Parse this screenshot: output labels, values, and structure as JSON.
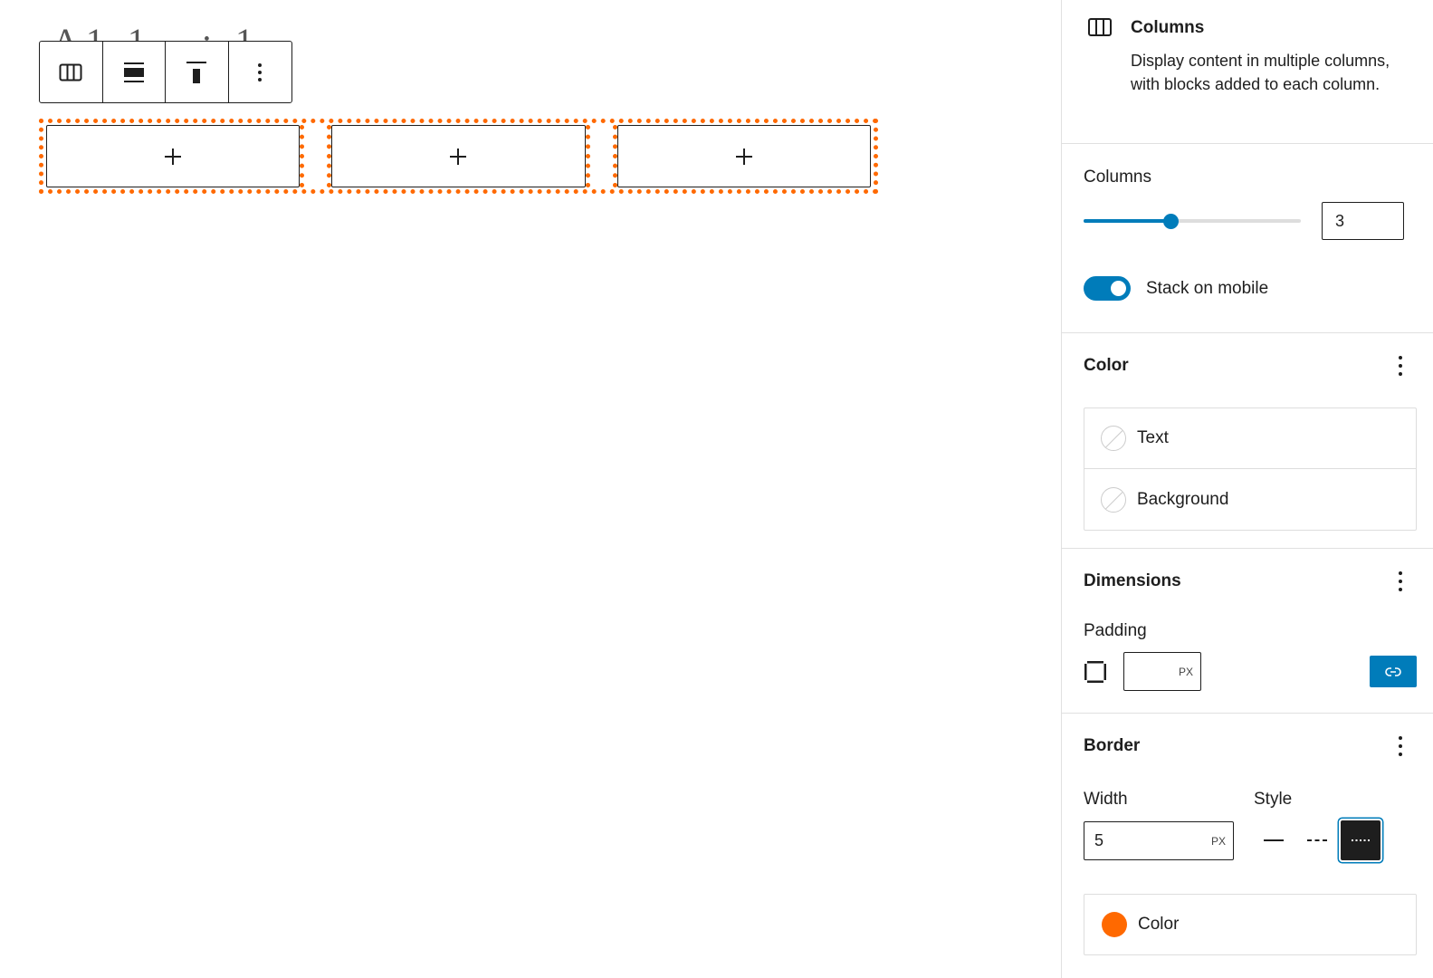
{
  "canvas": {
    "ghost_title": "A1 1 , : 1",
    "toolbar": {
      "items": [
        {
          "name": "block-type-columns-button",
          "icon": "columns-icon"
        },
        {
          "name": "align-button",
          "icon": "align-wide-icon"
        },
        {
          "name": "vertical-align-button",
          "icon": "align-top-icon"
        },
        {
          "name": "more-options-button",
          "icon": "vertical-ellipsis-icon"
        }
      ]
    },
    "columns": [
      {
        "appender": "+"
      },
      {
        "appender": "+"
      },
      {
        "appender": "+"
      }
    ],
    "border_color": "#ff6900"
  },
  "sidebar": {
    "block_card": {
      "title": "Columns",
      "description": "Display content in multiple columns, with blocks added to each column."
    },
    "settings": {
      "columns_label": "Columns",
      "columns_value": "3",
      "columns_min": 1,
      "columns_max": 6,
      "stack_label": "Stack on mobile",
      "stack_on": true
    },
    "color": {
      "heading": "Color",
      "items": [
        {
          "label": "Text"
        },
        {
          "label": "Background"
        }
      ]
    },
    "dimensions": {
      "heading": "Dimensions",
      "padding_label": "Padding",
      "padding_value": "",
      "padding_unit": "PX"
    },
    "border": {
      "heading": "Border",
      "width_label": "Width",
      "style_label": "Style",
      "width_value": "5",
      "width_unit": "PX",
      "styles": [
        "solid",
        "dashed",
        "dotted"
      ],
      "selected_style": "dotted",
      "color_label": "Color",
      "color_value": "#ff6900"
    },
    "accent_color": "#007cba"
  }
}
